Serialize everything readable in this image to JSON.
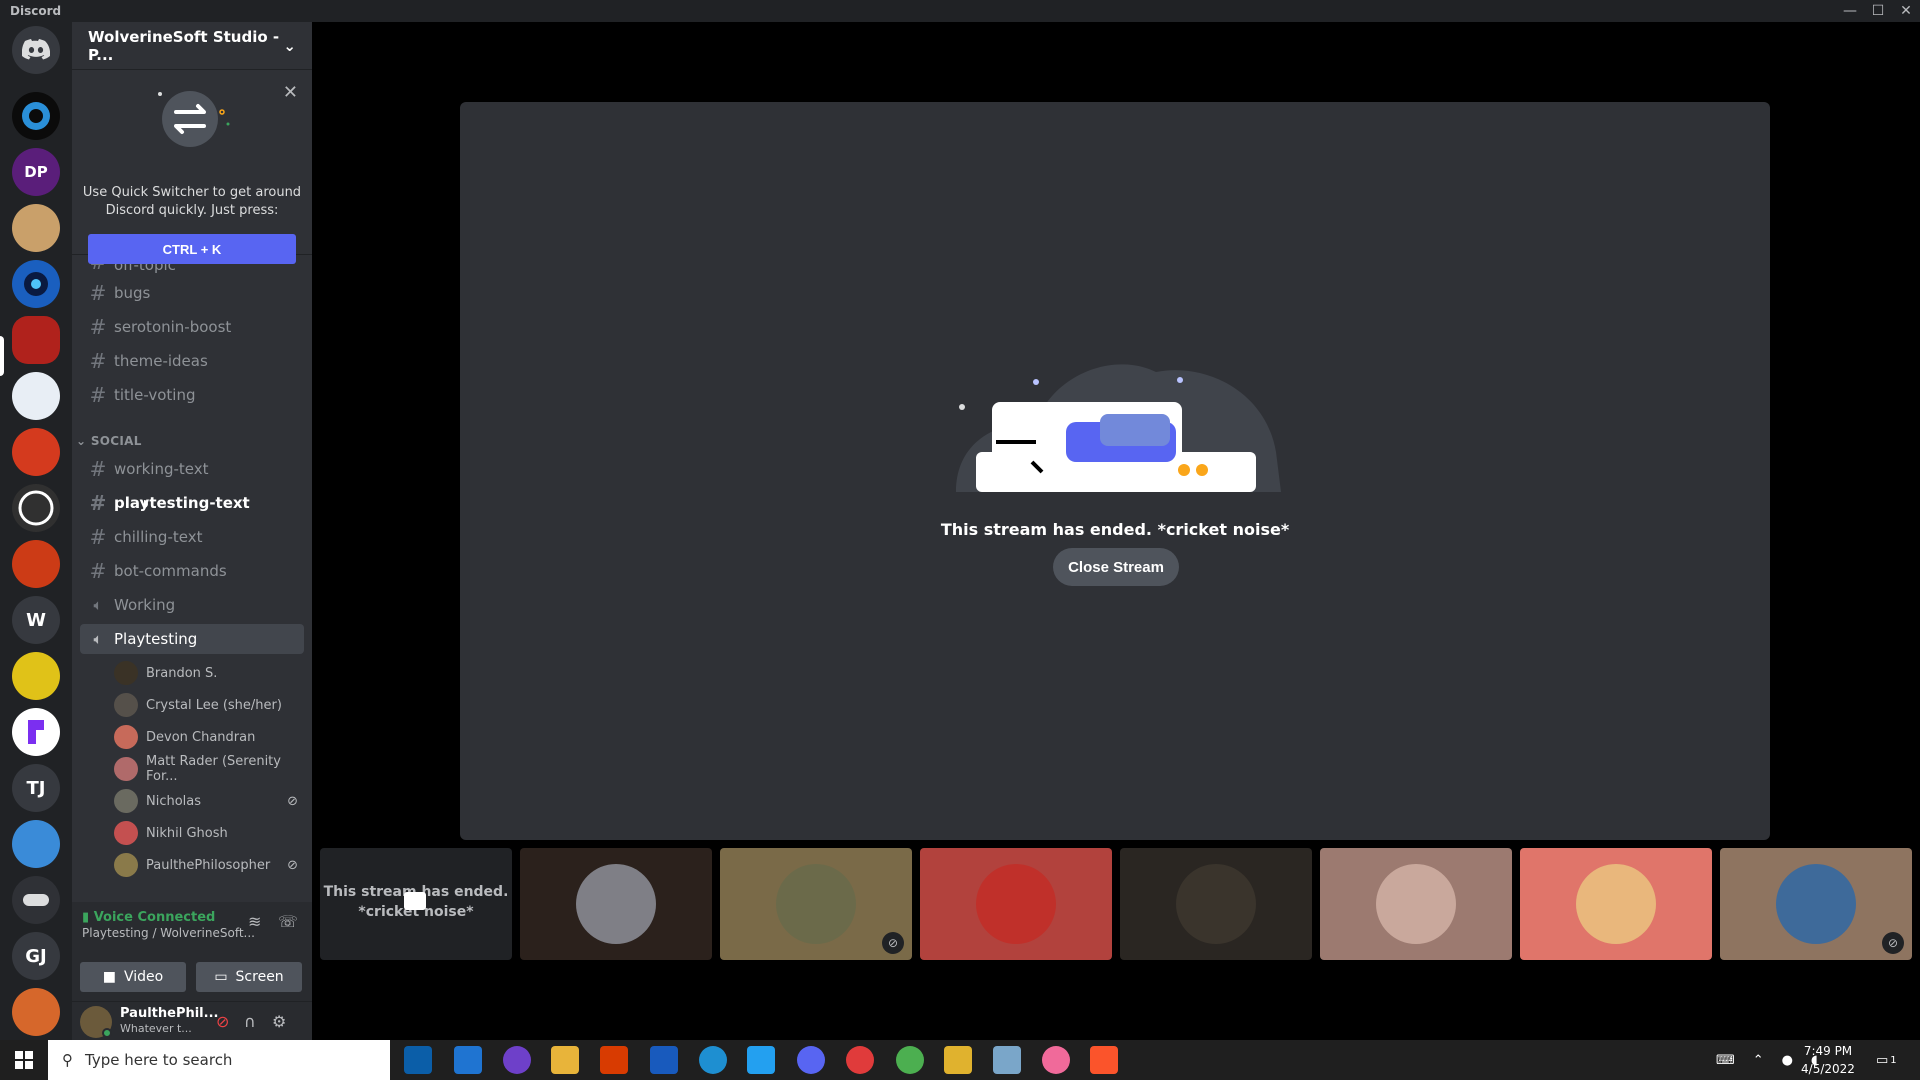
{
  "window": {
    "title": "Discord",
    "controls": [
      "—",
      "☐",
      "✕"
    ]
  },
  "servers": [
    {
      "kind": "home",
      "label": ""
    },
    {
      "kind": "img",
      "color": "#0b0b0b"
    },
    {
      "kind": "img",
      "color": "#5a1e7a"
    },
    {
      "kind": "img",
      "color": "#c9a06a"
    },
    {
      "kind": "img",
      "color": "#1a5fbf"
    },
    {
      "kind": "img",
      "color": "#b0221c"
    },
    {
      "kind": "img",
      "color": "#e8eef5"
    },
    {
      "kind": "img",
      "color": "#d43a1e"
    },
    {
      "kind": "img",
      "color": "#303030"
    },
    {
      "kind": "img",
      "color": "#cc3b16"
    },
    {
      "kind": "text",
      "label": "W"
    },
    {
      "kind": "img",
      "color": "#e0c218"
    },
    {
      "kind": "img",
      "color": "#7b2ff0"
    },
    {
      "kind": "text",
      "label": "TJ"
    },
    {
      "kind": "img",
      "color": "#3a8bd8"
    },
    {
      "kind": "img",
      "color": "#2f3136"
    },
    {
      "kind": "text",
      "label": "GJ"
    },
    {
      "kind": "img",
      "color": "#d6672b"
    }
  ],
  "guild": {
    "name": "WolverineSoft Studio - P...",
    "chevron": "⌄"
  },
  "quick_switcher": {
    "text": "Use Quick Switcher to get around Discord quickly. Just press:",
    "shortcut": "CTRL + K",
    "close": "✕"
  },
  "channels": {
    "top": [
      {
        "name": "off-topic",
        "kind": "text"
      },
      {
        "name": "bugs",
        "kind": "text"
      },
      {
        "name": "serotonin-boost",
        "kind": "text"
      },
      {
        "name": "theme-ideas",
        "kind": "text"
      },
      {
        "name": "title-voting",
        "kind": "text"
      }
    ],
    "social_label": "SOCIAL",
    "social": [
      {
        "name": "working-text",
        "kind": "text"
      },
      {
        "name": "playtesting-text",
        "kind": "text",
        "bold": true
      },
      {
        "name": "chilling-text",
        "kind": "text"
      },
      {
        "name": "bot-commands",
        "kind": "text"
      },
      {
        "name": "Working",
        "kind": "voice"
      },
      {
        "name": "Playtesting",
        "kind": "voice",
        "active": true
      }
    ]
  },
  "voice_users": [
    {
      "name": "Brandon S.",
      "color": "#3a3226",
      "muted": false
    },
    {
      "name": "Crystal Lee (she/her)",
      "color": "#55504a",
      "muted": false
    },
    {
      "name": "Devon Chandran",
      "color": "#c76a5a",
      "muted": false
    },
    {
      "name": "Matt Rader (Serenity For...",
      "color": "#b06a6a",
      "muted": false
    },
    {
      "name": "Nicholas",
      "color": "#6a6a60",
      "muted": true
    },
    {
      "name": "Nikhil Ghosh",
      "color": "#c45050",
      "muted": false
    },
    {
      "name": "PaulthePhilosopher",
      "color": "#8a7a4a",
      "muted": true
    }
  ],
  "voice_panel": {
    "status": "Voice Connected",
    "channel": "Playtesting / WolverineSoft...",
    "video_label": "Video",
    "screen_label": "Screen"
  },
  "user_panel": {
    "name": "PaulthePhil...",
    "status": "Whatever t..."
  },
  "stream": {
    "message": "This stream has ended. *cricket noise*",
    "close_label": "Close Stream"
  },
  "tiles": [
    {
      "kind": "ended",
      "text_line1": "This stream has ended.",
      "text_line2": "*cricket noise*",
      "bg": "#202225"
    },
    {
      "kind": "face",
      "bg": "#2b211c",
      "face": "#7f7f86",
      "muted": false
    },
    {
      "kind": "face",
      "bg": "#7a6a48",
      "face": "#6b6a4a",
      "muted": true
    },
    {
      "kind": "face",
      "bg": "#b2423d",
      "face": "#c0302a",
      "muted": false
    },
    {
      "kind": "face",
      "bg": "#2a2622",
      "face": "#3a342c",
      "muted": false
    },
    {
      "kind": "face",
      "bg": "#9c7a70",
      "face": "#c9a89c",
      "muted": false
    },
    {
      "kind": "face",
      "bg": "#e0756a",
      "face": "#e9b77c",
      "muted": false
    },
    {
      "kind": "face",
      "bg": "#8e7460",
      "face": "#3e6a9a",
      "muted": true
    }
  ],
  "taskbar": {
    "search_placeholder": "Type here to search",
    "apps": [
      "#0b5ea8",
      "#1f74d1",
      "#6e40c9",
      "#e8b43a",
      "#d83b01",
      "#185abd",
      "#1e8fd1",
      "#23a0f0",
      "#5865f2",
      "#e03b3b",
      "#4caf50",
      "#e0b22e",
      "#7aa6c9",
      "#f06a9a",
      "#fb542b"
    ],
    "time": "7:49 PM",
    "date": "4/5/2022",
    "notification_count": "1"
  }
}
